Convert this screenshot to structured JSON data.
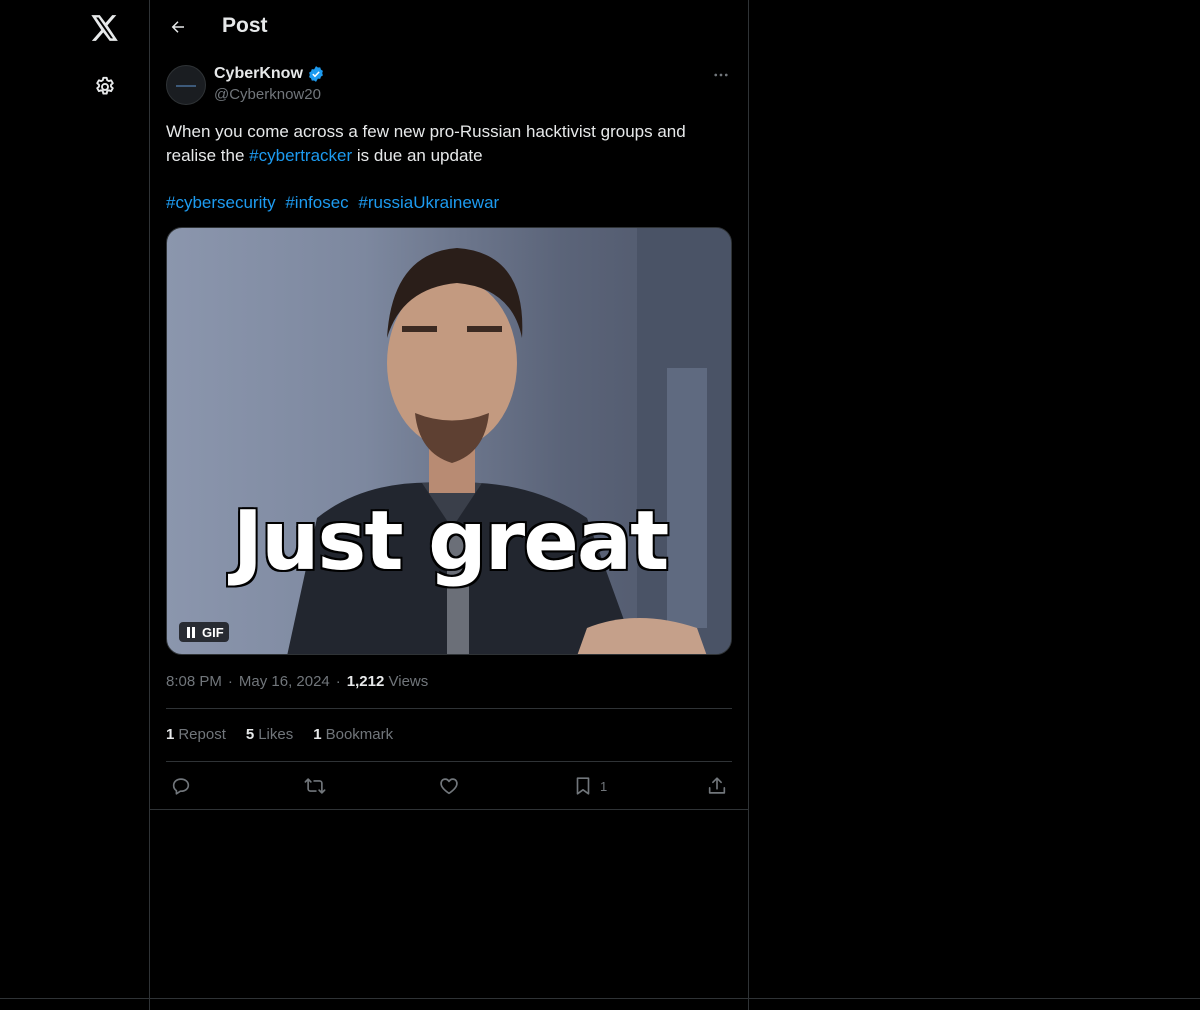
{
  "header": {
    "title": "Post"
  },
  "author": {
    "display_name": "CyberKnow",
    "handle": "@Cyberknow20"
  },
  "tweet": {
    "line1": "When you come across a few new pro-Russian hacktivist groups and",
    "line2_prefix": "realise the ",
    "line2_tag": "#cybertracker",
    "line2_suffix": " is due an update",
    "hashtags": [
      "#cybersecurity",
      "#infosec",
      "#russiaUkrainewar"
    ]
  },
  "media": {
    "caption_text": "Just great",
    "badge": "GIF"
  },
  "meta": {
    "time": "8:08 PM",
    "date": "May 16, 2024",
    "views_count": "1,212",
    "views_label": "Views"
  },
  "stats": [
    {
      "count": "1",
      "label": "Repost"
    },
    {
      "count": "5",
      "label": "Likes"
    },
    {
      "count": "1",
      "label": "Bookmark"
    }
  ],
  "actions": {
    "bookmark_count": "1"
  },
  "colors": {
    "background": "#000000",
    "text": "#e7e9ea",
    "muted": "#71767b",
    "accent": "#1d9bf0",
    "border": "#2f3336"
  },
  "icons": [
    "x-logo-icon",
    "settings-icon",
    "back-arrow-icon",
    "verified-badge-icon",
    "more-icon",
    "pause-icon",
    "reply-icon",
    "repost-icon",
    "like-icon",
    "bookmark-icon",
    "share-icon"
  ]
}
